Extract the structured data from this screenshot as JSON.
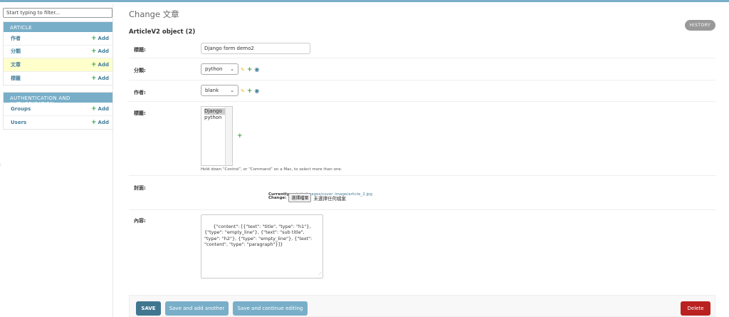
{
  "sidebar": {
    "filter_placeholder": "Start typing to filter...",
    "edge_glyph": "ː",
    "modules": [
      {
        "caption": "Article",
        "rows": [
          {
            "name": "作者",
            "add": "Add"
          },
          {
            "name": "分類",
            "add": "Add"
          },
          {
            "name": "文章",
            "add": "Add"
          },
          {
            "name": "標籤",
            "add": "Add"
          }
        ]
      },
      {
        "caption": "Authentication and Authorization",
        "rows": [
          {
            "name": "Groups",
            "add": "Add"
          },
          {
            "name": "Users",
            "add": "Add"
          }
        ]
      }
    ]
  },
  "main": {
    "page_title": "Change 文章",
    "history_label": "HISTORY",
    "object_title": "ArticleV2 object (2)"
  },
  "form": {
    "title": {
      "label": "標題:",
      "value": "Django form demo2"
    },
    "category": {
      "label": "分類:",
      "selected": "python"
    },
    "author": {
      "label": "作者:",
      "selected": "blank"
    },
    "tags": {
      "label": "標籤:",
      "options": [
        "Django",
        "python"
      ],
      "help": "Hold down “Control”, or “Command” on a Mac, to select more than one."
    },
    "cover": {
      "label": "封面:",
      "currently_label": "Currently:",
      "currently_link": "static/images/cover_image/article_2.jpg",
      "change_label": "Change:",
      "button_label": "選擇檔案",
      "no_file_text": "未選擇任何檔案"
    },
    "content": {
      "label": "內容:",
      "value": "{\"content\": [{\"text\": \"title\", \"type\": \"h1\"}, {\"type\": \"empty_line\"}, {\"text\": \"sub title\", \"type\": \"h2\"}, {\"type\": \"empty_line\"}, {\"text\": \"content\", \"type\": \"paragraph\"}]}"
    }
  },
  "actions": {
    "save": "SAVE",
    "save_add_another": "Save and add another",
    "save_continue": "Save and continue editing",
    "delete": "Delete"
  },
  "icons": {
    "plus": "+",
    "pencil": "✎",
    "eye": "◉",
    "chevron": "⌄",
    "resize": "⟋"
  },
  "colors": {
    "header_blue": "#79aec8",
    "link_blue": "#447e9b",
    "add_green": "#3fa44a",
    "active_row": "#ffffcc",
    "save_button": "#417690",
    "delete_red": "#ba2121"
  }
}
